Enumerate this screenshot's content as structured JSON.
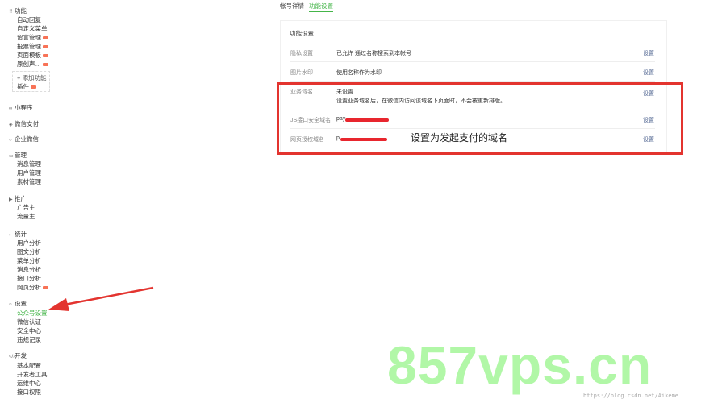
{
  "sidebar": {
    "func_section": "功能",
    "func_items": [
      "自动回复",
      "自定义菜单",
      "留言管理",
      "投票管理",
      "页面模板",
      "原创声…"
    ],
    "add_function": "+ 添加功能",
    "add_function_sub": "插件",
    "mini_program": "小程序",
    "wechat_pay": "微信支付",
    "enterprise_wechat": "企业微信",
    "manage_section": "管理",
    "manage_items": [
      "消息管理",
      "用户管理",
      "素材管理"
    ],
    "promote_section": "推广",
    "promote_items": [
      "广告主",
      "流量主"
    ],
    "stats_section": "统计",
    "stats_items": [
      "用户分析",
      "图文分析",
      "菜单分析",
      "消息分析",
      "接口分析",
      "网页分析"
    ],
    "settings_section": "设置",
    "settings_items": [
      "公众号设置",
      "微信认证",
      "安全中心",
      "违规记录"
    ],
    "dev_section": "开发",
    "dev_items": [
      "基本配置",
      "开发者工具",
      "运维中心",
      "接口权限"
    ]
  },
  "tabs": [
    "帐号详情",
    "功能设置"
  ],
  "panel": {
    "title": "功能设置",
    "rows": [
      {
        "label": "隐私设置",
        "value": "已允许 通过名称搜索到本帐号",
        "link": "设置"
      },
      {
        "label": "图片水印",
        "value": "使用名称作为水印",
        "link": "设置"
      },
      {
        "label": "业务域名",
        "value": "未设置",
        "value2": "设置业务域名后，在微信内访问该域名下页面时，不会被重新排版。",
        "link": "设置"
      },
      {
        "label": "JS接口安全域名",
        "value": "pay",
        "link": "设置"
      },
      {
        "label": "网页授权域名",
        "value": "p",
        "link": "设置"
      }
    ]
  },
  "annotation": "设置为发起支付的域名",
  "watermark": "857vps.cn",
  "source_url": "https://blog.csdn.net/Aikeme",
  "colors": {
    "accent": "#44b549",
    "link": "#576b95",
    "highlight": "#e3342f",
    "watermark": "#98f58a"
  }
}
